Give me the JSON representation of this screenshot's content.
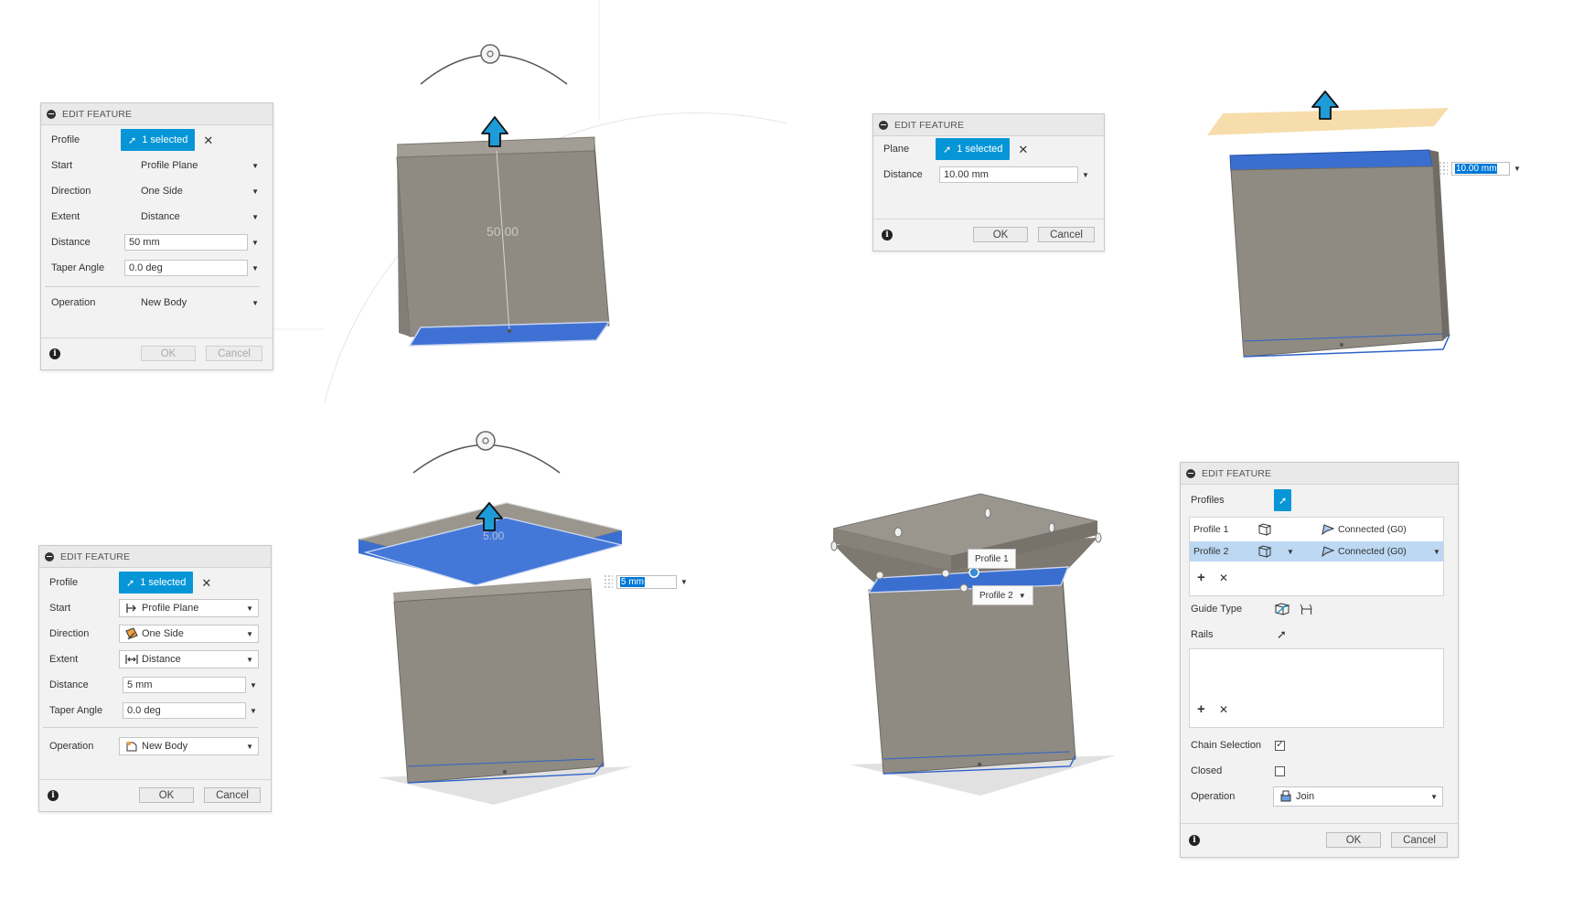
{
  "colors": {
    "accent": "#0696d7",
    "body_gray": "#908c83",
    "body_dark": "#7a766e",
    "face_blue": "#3a6fd0",
    "plane_tan": "#f5d59a"
  },
  "dialog1": {
    "title": "EDIT FEATURE",
    "profile": {
      "label": "Profile",
      "value": "1 selected"
    },
    "start": {
      "label": "Start",
      "value": "Profile Plane"
    },
    "direction": {
      "label": "Direction",
      "value": "One Side"
    },
    "extent": {
      "label": "Extent",
      "value": "Distance"
    },
    "distance": {
      "label": "Distance",
      "value": "50 mm"
    },
    "taper": {
      "label": "Taper Angle",
      "value": "0.0 deg"
    },
    "operation": {
      "label": "Operation",
      "value": "New Body"
    },
    "ok": "OK",
    "cancel": "Cancel"
  },
  "canvas1": {
    "dimension_label": "50.00"
  },
  "dialog2": {
    "title": "EDIT FEATURE",
    "plane": {
      "label": "Plane",
      "value": "1 selected"
    },
    "distance": {
      "label": "Distance",
      "value": "10.00 mm"
    },
    "ok": "OK",
    "cancel": "Cancel"
  },
  "canvas2": {
    "value_box": "10.00 mm"
  },
  "dialog3": {
    "title": "EDIT FEATURE",
    "profile": {
      "label": "Profile",
      "value": "1 selected"
    },
    "start": {
      "label": "Start",
      "value": "Profile Plane"
    },
    "direction": {
      "label": "Direction",
      "value": "One Side"
    },
    "extent": {
      "label": "Extent",
      "value": "Distance"
    },
    "distance": {
      "label": "Distance",
      "value": "5 mm"
    },
    "taper": {
      "label": "Taper Angle",
      "value": "0.0 deg"
    },
    "operation": {
      "label": "Operation",
      "value": "New Body"
    },
    "ok": "OK",
    "cancel": "Cancel"
  },
  "canvas3": {
    "value_box": "5 mm",
    "dimension_label": "5.00"
  },
  "canvas4": {
    "tag1": "Profile 1",
    "tag2": "Profile 2"
  },
  "dialog4": {
    "title": "EDIT FEATURE",
    "profiles_label": "Profiles",
    "profiles": [
      {
        "name": "Profile 1",
        "connection": "Connected (G0)"
      },
      {
        "name": "Profile 2",
        "connection": "Connected (G0)"
      }
    ],
    "guide_type_label": "Guide Type",
    "rails_label": "Rails",
    "chain_selection_label": "Chain Selection",
    "closed_label": "Closed",
    "operation": {
      "label": "Operation",
      "value": "Join"
    },
    "ok": "OK",
    "cancel": "Cancel"
  }
}
